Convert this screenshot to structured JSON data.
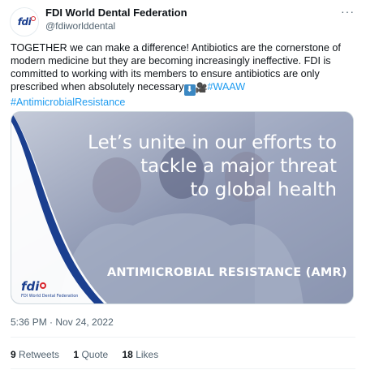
{
  "author": {
    "name": "FDI World Dental Federation",
    "handle": "@fdiworlddental",
    "avatar_text": "fdi"
  },
  "more_icon": "···",
  "tweet": {
    "text": "TOGETHER we can make a difference! Antibiotics are the cornerstone of modern medicine but they are becoming increasingly ineffective. FDI is committed to working with its members to ensure antibiotics are only prescribed when absolutely necessary",
    "emoji_down": "⬇",
    "emoji_camera": "🎥",
    "hashtag_1": "#WAAW",
    "hashtag_2": "#AntimicrobialResistance"
  },
  "media": {
    "headline_1": "Let’s unite in our efforts to",
    "headline_2": "tackle a major threat",
    "headline_3": "to global health",
    "banner": "ANTIMICROBIAL RESISTANCE (AMR)",
    "logo": "fdi",
    "logo_sub": "FDI World Dental Federation"
  },
  "timestamp": "5:36 PM · Nov 24, 2022",
  "stats": {
    "retweets_count": "9",
    "retweets_label": "Retweets",
    "quotes_count": "1",
    "quotes_label": "Quote",
    "likes_count": "18",
    "likes_label": "Likes"
  },
  "colors": {
    "link": "#1d9bf0",
    "brand_blue": "#1b3f8f",
    "brand_red": "#d9262e"
  }
}
